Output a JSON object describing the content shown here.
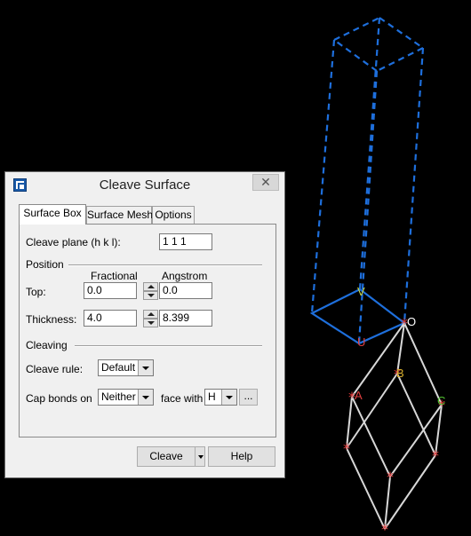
{
  "viewport": {
    "atom_labels": {
      "vector_v": "V",
      "vector_u": "U",
      "origin": "O",
      "atom_a": "A",
      "atom_b": "B",
      "atom_c": "C"
    },
    "colors": {
      "cleave_box": "#1e6fdc",
      "lattice": "#d8d8d8",
      "atom_marker": "#e03a3a",
      "label_v": "#c9d94a",
      "label_u": "#e04040",
      "label_o": "#ffffff",
      "label_a": "#e04040",
      "label_b": "#d8b030",
      "label_c": "#50c030"
    }
  },
  "dialog": {
    "title": "Cleave Surface",
    "icons": {
      "app": "app-icon",
      "close": "close-icon"
    },
    "close_label": "✕",
    "tabs": [
      {
        "label": "Surface Box",
        "active": true
      },
      {
        "label": "Surface Mesh",
        "active": false
      },
      {
        "label": "Options",
        "active": false
      }
    ],
    "cleave_plane": {
      "label": "Cleave plane (h k l):",
      "value": "1  1  1"
    },
    "position": {
      "group_label": "Position",
      "col_fractional": "Fractional",
      "col_angstrom": "Angstrom",
      "top": {
        "label": "Top:",
        "fractional": "0.0",
        "angstrom": "0.0"
      },
      "thickness": {
        "label": "Thickness:",
        "fractional": "4.0",
        "angstrom": "8.399"
      }
    },
    "cleaving": {
      "group_label": "Cleaving",
      "cleave_rule": {
        "label": "Cleave rule:",
        "value": "Default"
      },
      "cap_bonds": {
        "label": "Cap bonds on",
        "value": "Neither",
        "face_label": "face with",
        "face_value": "H",
        "ellipsis": "..."
      }
    },
    "buttons": {
      "cleave": "Cleave",
      "help": "Help"
    }
  }
}
